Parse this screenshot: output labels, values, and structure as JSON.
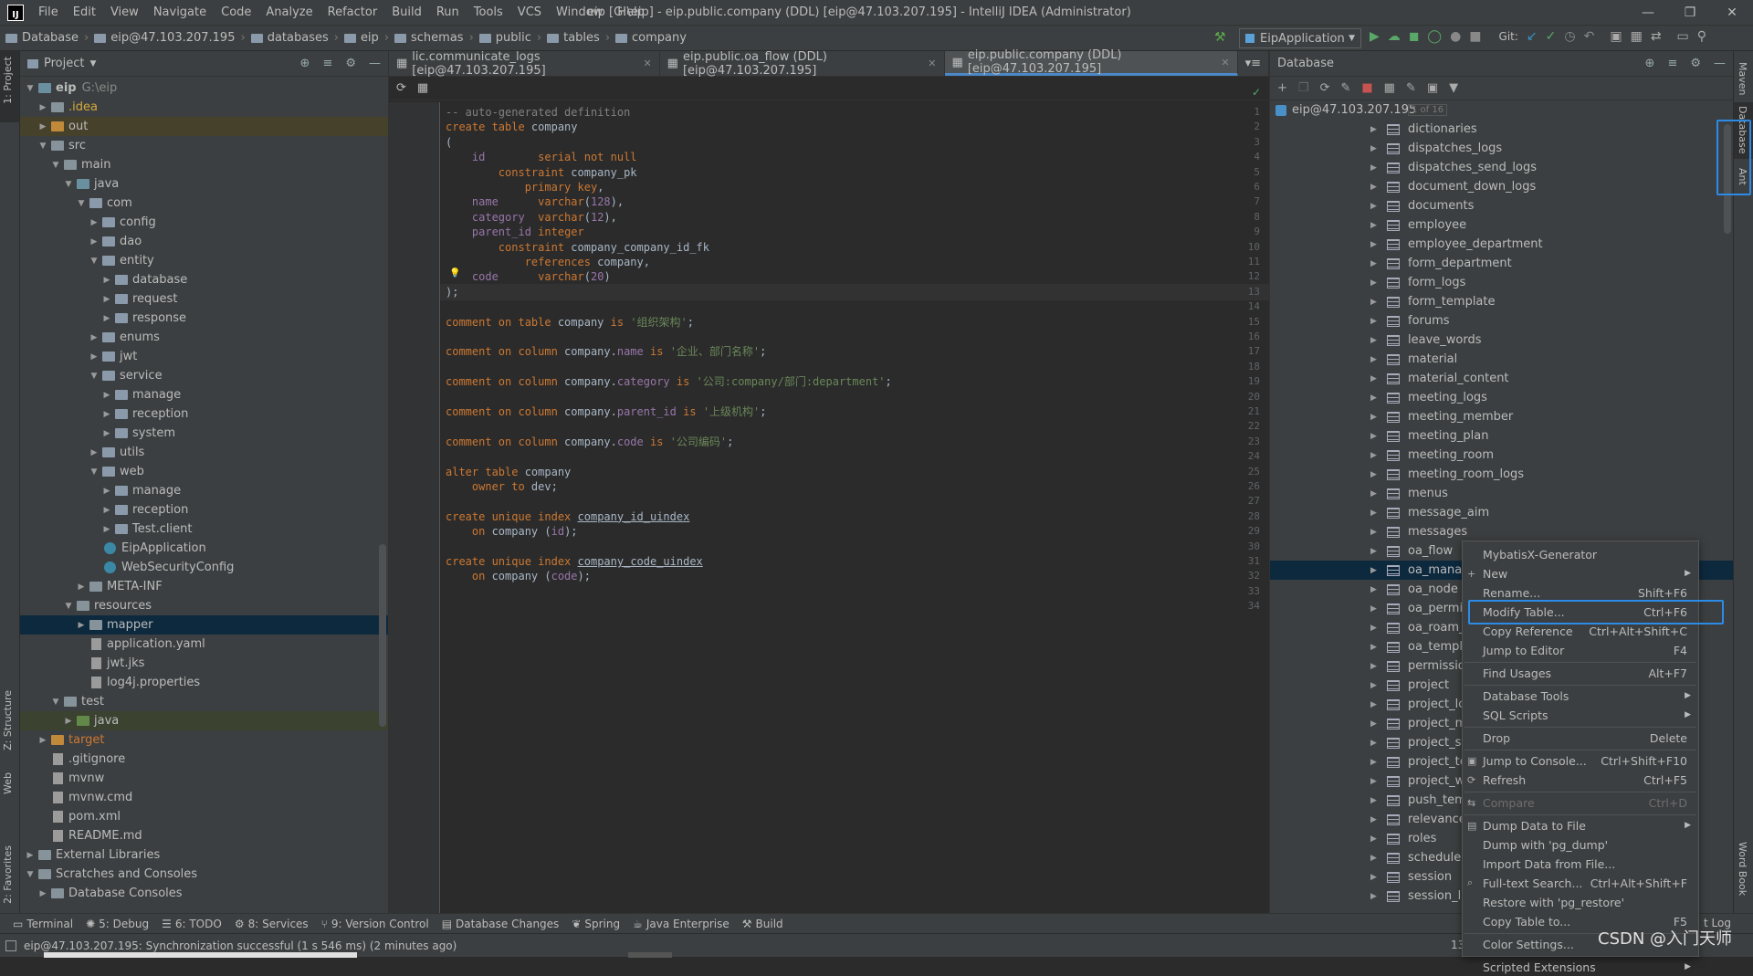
{
  "menubar": {
    "items": [
      "File",
      "Edit",
      "View",
      "Navigate",
      "Code",
      "Analyze",
      "Refactor",
      "Build",
      "Run",
      "Tools",
      "VCS",
      "Window",
      "Help"
    ],
    "title": "eip [G:\\eip] - eip.public.company (DDL) [eip@47.103.207.195] - IntelliJ IDEA (Administrator)"
  },
  "breadcrumb": [
    "Database",
    "eip@47.103.207.195",
    "databases",
    "eip",
    "schemas",
    "public",
    "tables",
    "company"
  ],
  "run_config": "EipApplication",
  "git_label": "Git:",
  "left_tabs": {
    "project": "1: Project",
    "structure": "Z: Structure",
    "web": "Web",
    "favorites": "2: Favorites"
  },
  "right_tabs": {
    "maven": "Maven",
    "database": "Database",
    "ant": "Ant",
    "wordbook": "Word Book"
  },
  "project_panel": {
    "title": "Project",
    "tree": [
      {
        "label": "eip",
        "extra": "G:\\eip",
        "depth": 0,
        "open": true,
        "kind": "src"
      },
      {
        "label": ".idea",
        "depth": 1,
        "open": false,
        "kind": "folder",
        "color": "yellow"
      },
      {
        "label": "out",
        "depth": 1,
        "open": false,
        "kind": "orange",
        "hl": "hl"
      },
      {
        "label": "src",
        "depth": 1,
        "open": true,
        "kind": "folder"
      },
      {
        "label": "main",
        "depth": 2,
        "open": true,
        "kind": "folder"
      },
      {
        "label": "java",
        "depth": 3,
        "open": true,
        "kind": "src"
      },
      {
        "label": "com",
        "depth": 4,
        "open": true,
        "kind": "pkg"
      },
      {
        "label": "config",
        "depth": 5,
        "open": false,
        "kind": "pkg"
      },
      {
        "label": "dao",
        "depth": 5,
        "open": false,
        "kind": "pkg"
      },
      {
        "label": "entity",
        "depth": 5,
        "open": true,
        "kind": "pkg"
      },
      {
        "label": "database",
        "depth": 6,
        "open": false,
        "kind": "pkg"
      },
      {
        "label": "request",
        "depth": 6,
        "open": false,
        "kind": "pkg"
      },
      {
        "label": "response",
        "depth": 6,
        "open": false,
        "kind": "pkg"
      },
      {
        "label": "enums",
        "depth": 5,
        "open": false,
        "kind": "pkg"
      },
      {
        "label": "jwt",
        "depth": 5,
        "open": false,
        "kind": "pkg"
      },
      {
        "label": "service",
        "depth": 5,
        "open": true,
        "kind": "pkg"
      },
      {
        "label": "manage",
        "depth": 6,
        "open": false,
        "kind": "pkg"
      },
      {
        "label": "reception",
        "depth": 6,
        "open": false,
        "kind": "pkg"
      },
      {
        "label": "system",
        "depth": 6,
        "open": false,
        "kind": "pkg"
      },
      {
        "label": "utils",
        "depth": 5,
        "open": false,
        "kind": "pkg"
      },
      {
        "label": "web",
        "depth": 5,
        "open": true,
        "kind": "pkg"
      },
      {
        "label": "manage",
        "depth": 6,
        "open": false,
        "kind": "pkg"
      },
      {
        "label": "reception",
        "depth": 6,
        "open": false,
        "kind": "pkg"
      },
      {
        "label": "Test.client",
        "depth": 6,
        "open": false,
        "kind": "pkg"
      },
      {
        "label": "EipApplication",
        "depth": 5,
        "kind": "class"
      },
      {
        "label": "WebSecurityConfig",
        "depth": 5,
        "kind": "class"
      },
      {
        "label": "META-INF",
        "depth": 4,
        "open": false,
        "kind": "folder"
      },
      {
        "label": "resources",
        "depth": 3,
        "open": true,
        "kind": "folder"
      },
      {
        "label": "mapper",
        "depth": 4,
        "open": false,
        "kind": "folder",
        "hl": "sel"
      },
      {
        "label": "application.yaml",
        "depth": 4,
        "kind": "file"
      },
      {
        "label": "jwt.jks",
        "depth": 4,
        "kind": "file"
      },
      {
        "label": "log4j.properties",
        "depth": 4,
        "kind": "file"
      },
      {
        "label": "test",
        "depth": 2,
        "open": true,
        "kind": "folder"
      },
      {
        "label": "java",
        "depth": 3,
        "open": false,
        "kind": "green",
        "hl": "hl2"
      },
      {
        "label": "target",
        "depth": 1,
        "open": false,
        "kind": "orange",
        "color": "orange"
      },
      {
        "label": ".gitignore",
        "depth": 1,
        "kind": "file"
      },
      {
        "label": "mvnw",
        "depth": 1,
        "kind": "file"
      },
      {
        "label": "mvnw.cmd",
        "depth": 1,
        "kind": "file"
      },
      {
        "label": "pom.xml",
        "depth": 1,
        "kind": "file"
      },
      {
        "label": "README.md",
        "depth": 1,
        "kind": "file"
      },
      {
        "label": "External Libraries",
        "depth": 0,
        "open": false,
        "kind": "folder"
      },
      {
        "label": "Scratches and Consoles",
        "depth": 0,
        "open": true,
        "kind": "folder"
      },
      {
        "label": "Database Consoles",
        "depth": 1,
        "open": false,
        "kind": "folder"
      }
    ]
  },
  "editor": {
    "tabs": [
      {
        "label": "lic.communicate_logs [eip@47.103.207.195]",
        "active": false
      },
      {
        "label": "eip.public.oa_flow (DDL) [eip@47.103.207.195]",
        "active": false
      },
      {
        "label": "eip.public.company (DDL) [eip@47.103.207.195]",
        "active": true
      }
    ],
    "tab_overflow": "▾≡",
    "lines": [
      "<span class='cm'>-- auto-generated definition</span>",
      "<span class='kw'>create table</span> company",
      "(",
      "    <span class='id'>id</span>        <span class='kw'>serial not null</span>",
      "        <span class='kw'>constraint</span> company_pk",
      "            <span class='kw'>primary key</span>,",
      "    <span class='id'>name</span>      <span class='kw'>varchar</span>(<span class='id'>128</span>),",
      "    <span class='id'>category</span>  <span class='kw'>varchar</span>(<span class='id'>12</span>),",
      "    <span class='id'>parent_id</span> <span class='kw'>integer</span>",
      "        <span class='kw'>constraint</span> company_company_id_fk",
      "            <span class='kw'>references</span> company,",
      "    <span class='id'>code</span>      <span class='kw'>varchar</span>(<span class='id'>20</span>)",
      ");",
      "",
      "<span class='kw'>comment on table</span> company <span class='kw'>is</span> <span class='str'>'组织架构'</span>;",
      "",
      "<span class='kw'>comment on column</span> company.<span class='id'>name</span> <span class='kw'>is</span> <span class='str'>'企业、部门名称'</span>;",
      "",
      "<span class='kw'>comment on column</span> company.<span class='id'>category</span> <span class='kw'>is</span> <span class='str'>'公司:company/部门:department'</span>;",
      "",
      "<span class='kw'>comment on column</span> company.<span class='id'>parent_id</span> <span class='kw'>is</span> <span class='str'>'上级机构'</span>;",
      "",
      "<span class='kw'>comment on column</span> company.<span class='id'>code</span> <span class='kw'>is</span> <span class='str'>'公司编码'</span>;",
      "",
      "<span class='kw'>alter table</span> company",
      "    <span class='kw'>owner to</span> dev;",
      "",
      "<span class='kw'>create unique index</span> <u>company_id_uindex</u>",
      "    <span class='kw'>on</span> company (<span class='id'>id</span>);",
      "",
      "<span class='kw'>create unique index</span> <u>company_code_uindex</u>",
      "    <span class='kw'>on</span> company (<span class='id'>code</span>);",
      "",
      ""
    ],
    "current_line": 13
  },
  "database_panel": {
    "title": "Database",
    "connection": "eip@47.103.207.195",
    "connection_badge": "1 of 16",
    "tables": [
      "dictionaries",
      "dispatches_logs",
      "dispatches_send_logs",
      "document_down_logs",
      "documents",
      "employee",
      "employee_department",
      "form_department",
      "form_logs",
      "form_template",
      "forums",
      "leave_words",
      "material",
      "material_content",
      "meeting_logs",
      "meeting_member",
      "meeting_plan",
      "meeting_room",
      "meeting_room_logs",
      "menus",
      "message_aim",
      "messages",
      "oa_flow",
      "oa_manag",
      "oa_node",
      "oa_permis",
      "oa_roam_l",
      "oa_templa",
      "permission",
      "project",
      "project_log",
      "project_me",
      "project_sta",
      "project_ter",
      "project_we",
      "push_temp",
      "relevance",
      "roles",
      "schedule",
      "session",
      "session_lo"
    ],
    "selected": "oa_manag"
  },
  "context_menu": [
    {
      "label": "MybatisX-Generator",
      "shortcut": ""
    },
    {
      "label": "New",
      "shortcut": "",
      "sub": true,
      "icon": "+"
    },
    {
      "label": "Rename...",
      "shortcut": "Shift+F6"
    },
    {
      "label": "Modify Table...",
      "shortcut": "Ctrl+F6",
      "boxed": true
    },
    {
      "label": "Copy Reference",
      "shortcut": "Ctrl+Alt+Shift+C"
    },
    {
      "label": "Jump to Editor",
      "shortcut": "F4"
    },
    {
      "sep": true
    },
    {
      "label": "Find Usages",
      "shortcut": "Alt+F7"
    },
    {
      "sep": true
    },
    {
      "label": "Database Tools",
      "shortcut": "",
      "sub": true
    },
    {
      "label": "SQL Scripts",
      "shortcut": "",
      "sub": true
    },
    {
      "sep": true
    },
    {
      "label": "Drop",
      "shortcut": "Delete"
    },
    {
      "sep": true
    },
    {
      "label": "Jump to Console...",
      "shortcut": "Ctrl+Shift+F10",
      "icon": "▣"
    },
    {
      "label": "Refresh",
      "shortcut": "Ctrl+F5",
      "icon": "⟳"
    },
    {
      "sep": true
    },
    {
      "label": "Compare",
      "shortcut": "Ctrl+D",
      "disabled": true,
      "icon": "⇆"
    },
    {
      "sep": true
    },
    {
      "label": "Dump Data to File",
      "shortcut": "",
      "sub": true,
      "icon": "▤"
    },
    {
      "label": "Dump with 'pg_dump'",
      "shortcut": ""
    },
    {
      "label": "Import Data from File...",
      "shortcut": ""
    },
    {
      "label": "Full-text Search...",
      "shortcut": "Ctrl+Alt+Shift+F",
      "icon": "⌕"
    },
    {
      "label": "Restore with 'pg_restore'",
      "shortcut": ""
    },
    {
      "label": "Copy Table to...",
      "shortcut": "F5"
    },
    {
      "sep": true
    },
    {
      "label": "Color Settings...",
      "shortcut": ""
    },
    {
      "sep": true
    },
    {
      "label": "Scripted Extensions",
      "shortcut": "",
      "sub": true
    }
  ],
  "bottom_tools": [
    "Terminal",
    "5: Debug",
    "6: TODO",
    "8: Services",
    "9: Version Control",
    "Database Changes",
    "Spring",
    "Java Enterprise",
    "Build"
  ],
  "bottom_right_fragment": "t Log",
  "status": {
    "message": "eip@47.103.207.195: Synchronization successful (1 s 546 ms) (2 minutes ago)",
    "fragment": "13",
    "progress": 1.0
  },
  "watermark": "CSDN @入门天师"
}
